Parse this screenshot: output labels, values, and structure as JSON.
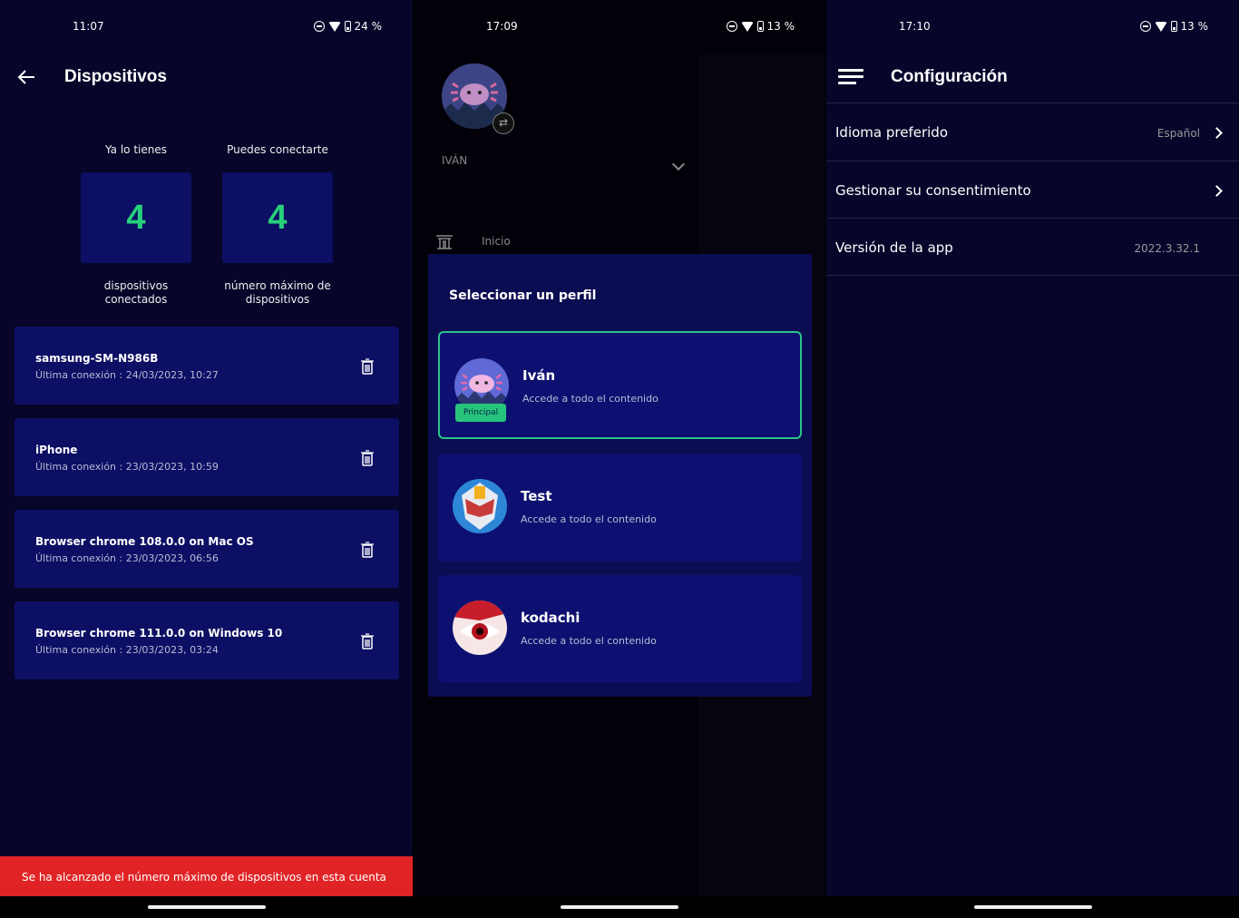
{
  "panel1": {
    "status": {
      "time": "11:07",
      "battery": "24 %"
    },
    "title": "Dispositivos",
    "stats": [
      {
        "caption": "Ya lo tienes",
        "value": "4",
        "desc1": "dispositivos",
        "desc2": "conectados"
      },
      {
        "caption": "Puedes conectarte",
        "value": "4",
        "desc1": "número máximo de",
        "desc2": "dispositivos"
      }
    ],
    "devices": [
      {
        "name": "samsung-SM-N986B",
        "last": "Última conexión : 24/03/2023, 10:27"
      },
      {
        "name": "iPhone",
        "last": "Última conexión : 23/03/2023, 10:59"
      },
      {
        "name": "Browser chrome 108.0.0 on Mac OS",
        "last": "Última conexión : 23/03/2023, 06:56"
      },
      {
        "name": "Browser chrome 111.0.0 on Windows 10",
        "last": "Última conexión : 23/03/2023, 03:24"
      }
    ],
    "banner": "Se ha alcanzado el número máximo de dispositivos en esta cuenta"
  },
  "panel2": {
    "status": {
      "time": "17:09",
      "battery": "13 %"
    },
    "drawer_user": "IVÁN",
    "drawer_home": "Inicio",
    "modal_title": "Seleccionar un perfil",
    "profiles": [
      {
        "name": "Iván",
        "desc": "Accede a todo el contenido",
        "badge": "Principal"
      },
      {
        "name": "Test",
        "desc": "Accede a todo el contenido"
      },
      {
        "name": "kodachi",
        "desc": "Accede a todo el contenido"
      }
    ],
    "colors": {
      "selected_border": "#2cc38a",
      "card": "#0d1070"
    }
  },
  "panel3": {
    "status": {
      "time": "17:10",
      "battery": "13 %"
    },
    "title": "Configuración",
    "settings": [
      {
        "label": "Idioma preferido",
        "value": "Español"
      },
      {
        "label": "Gestionar su consentimiento",
        "value": ""
      },
      {
        "label": "Versión de la app",
        "value": "2022.3.32.1"
      }
    ]
  },
  "colors": {
    "accent_green": "#27d17a",
    "banner_red": "#e02426",
    "panel_bg": "#07052a",
    "card_bg": "#0c0f63"
  }
}
